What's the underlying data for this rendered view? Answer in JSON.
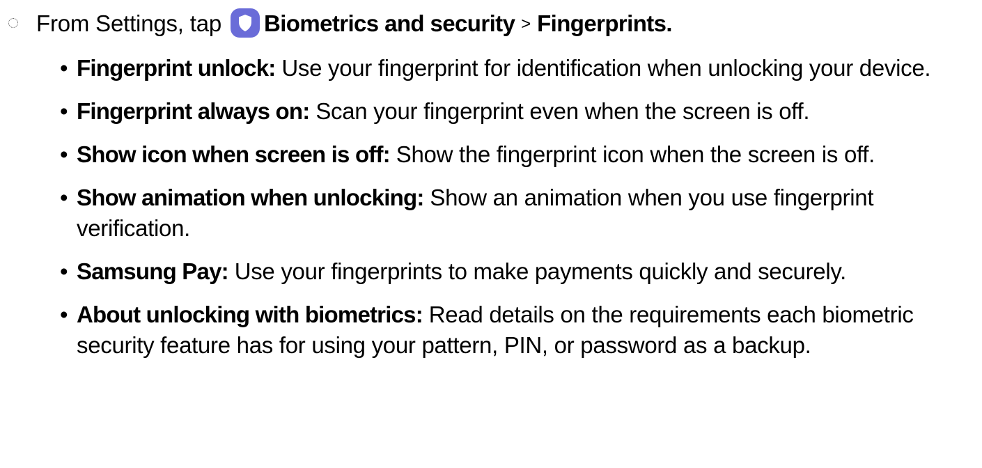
{
  "step": {
    "prefix": "From Settings, tap",
    "icon": "shield-icon",
    "icon_color": "#6a6cd8",
    "menu_item": "Biometrics and security",
    "separator": ">",
    "submenu_item": "Fingerprints."
  },
  "options": [
    {
      "bullet": "•",
      "term": "Fingerprint unlock:",
      "description": "Use your fingerprint for identification when unlocking your device."
    },
    {
      "bullet": "•",
      "term": "Fingerprint always on:",
      "description": "Scan your fingerprint even when the screen is off."
    },
    {
      "bullet": "•",
      "term": "Show icon when screen is off:",
      "description": "Show the fingerprint icon when the screen is off."
    },
    {
      "bullet": "•",
      "term": "Show animation when unlocking:",
      "description": "Show an animation when you use fingerprint verification."
    },
    {
      "bullet": "•",
      "term": "Samsung Pay:",
      "description": "Use your fingerprints to make payments quickly and securely."
    },
    {
      "bullet": "•",
      "term": "About unlocking with biometrics:",
      "description": "Read details on the requirements each biometric security feature has for using your pattern, PIN, or password as a backup."
    }
  ]
}
